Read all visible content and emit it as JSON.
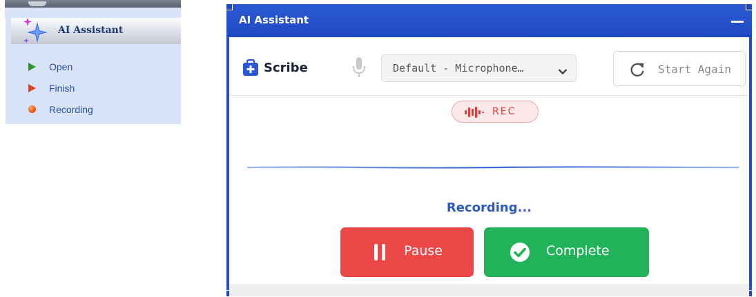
{
  "side_panel": {
    "title": "AI Assistant",
    "header_icon": "sparkle-icon",
    "items": [
      {
        "label": "Open",
        "icon": "play-green-icon"
      },
      {
        "label": "Finish",
        "icon": "play-red-icon"
      },
      {
        "label": "Recording",
        "icon": "record-dot-icon"
      }
    ]
  },
  "window": {
    "title": "AI Assistant",
    "toolbar": {
      "app_label": "Scribe",
      "app_icon": "medical-bag-icon",
      "mic_icon": "microphone-icon",
      "mic_select_value": "Default - Microphone…",
      "start_again_label": "Start Again",
      "start_again_icon": "refresh-icon"
    },
    "rec_badge_label": "REC",
    "status_text": "Recording...",
    "pause_label": "Pause",
    "complete_label": "Complete"
  },
  "colors": {
    "window_blue": "#1f4fc9",
    "pause_red": "#ec4747",
    "complete_green": "#22b35a",
    "status_blue": "#2d5bc6",
    "rec_red": "#e23b3b"
  }
}
